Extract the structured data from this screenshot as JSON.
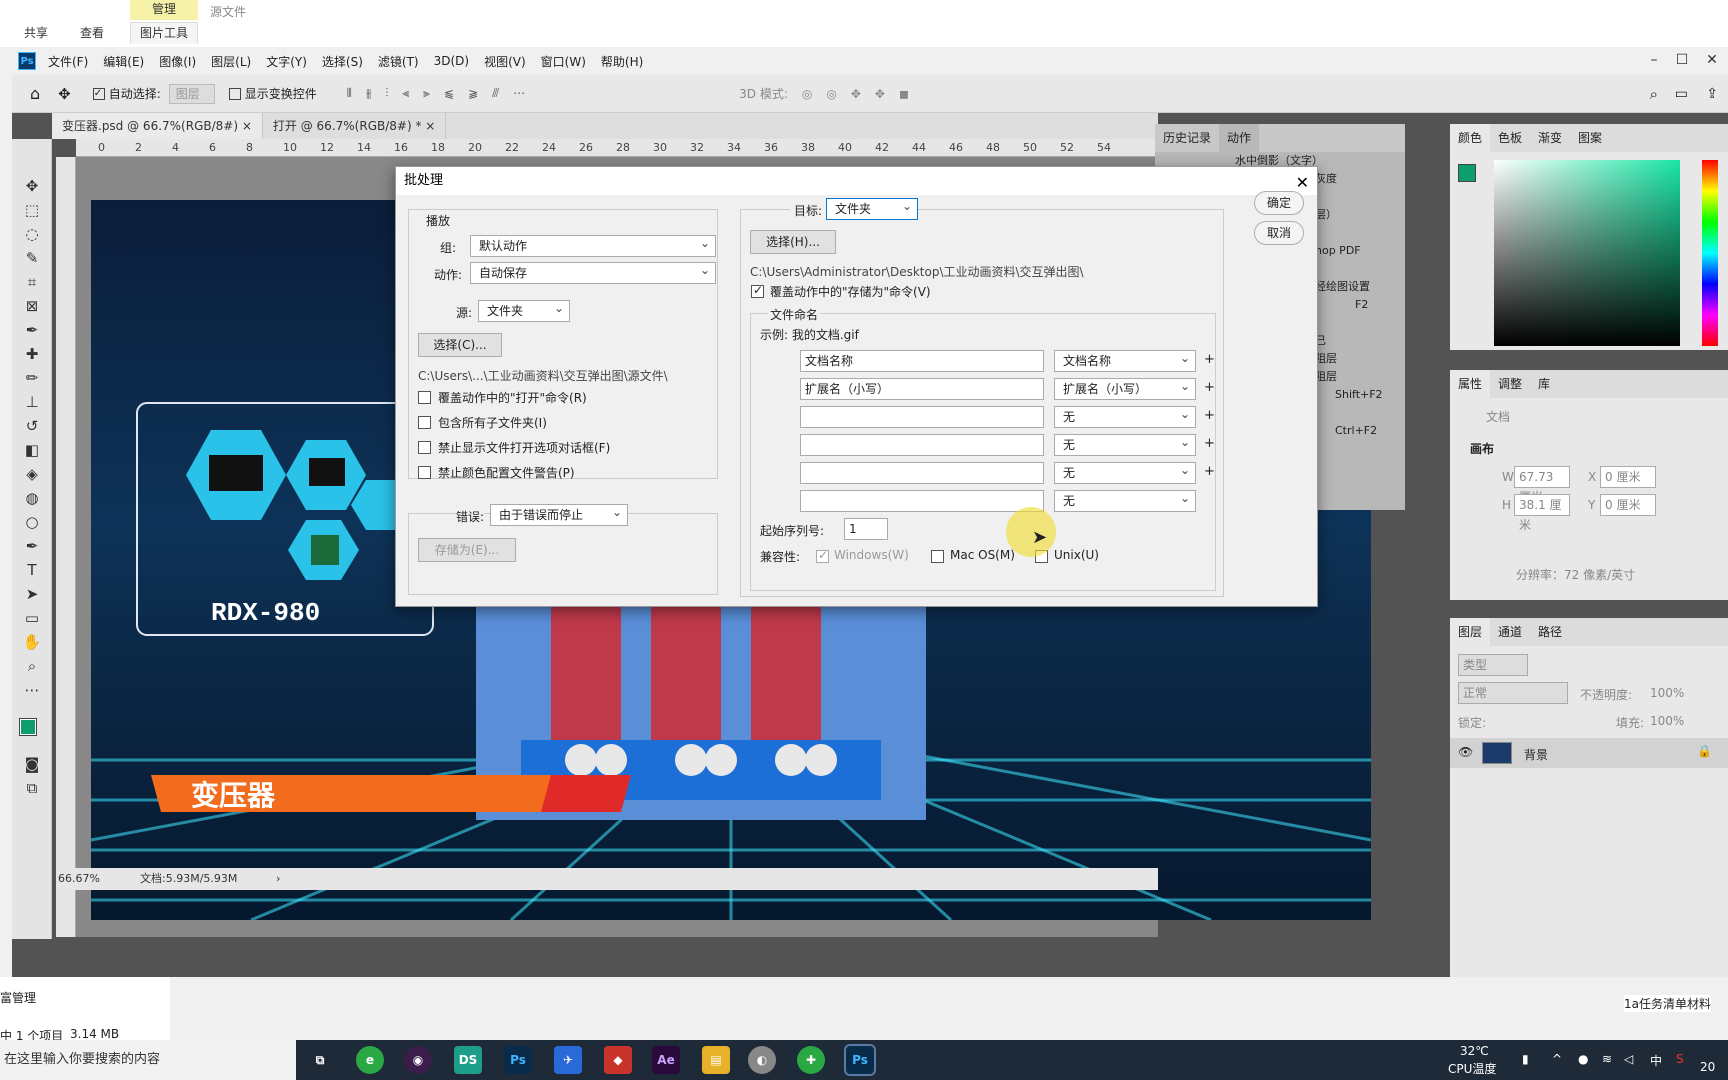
{
  "explorer": {
    "share": "共享",
    "view": "查看",
    "manage": "管理",
    "picture_tools": "图片工具",
    "source_folder": "源文件",
    "nav_item": "富管理",
    "status_items": "中 1 个项目",
    "status_size": "3.14 MB",
    "side_items": [
      "1a任务清单材料"
    ]
  },
  "photoshop": {
    "logo": "Ps",
    "menu": [
      "文件(F)",
      "编辑(E)",
      "图像(I)",
      "图层(L)",
      "文字(Y)",
      "选择(S)",
      "滤镜(T)",
      "3D(D)",
      "视图(V)",
      "窗口(W)",
      "帮助(H)"
    ],
    "options": {
      "auto_select": "自动选择:",
      "layer": "图层",
      "show_transform": "显示变换控件",
      "mode_3d": "3D 模式:"
    },
    "tabs": [
      {
        "label": "变压器.psd @ 66.7%(RGB/8#)"
      },
      {
        "label": "打开 @ 66.7%(RGB/8#) *"
      }
    ],
    "ruler_ticks": [
      "0",
      "2",
      "4",
      "6",
      "8",
      "10",
      "12",
      "14",
      "16",
      "18",
      "20",
      "22",
      "24",
      "26",
      "28",
      "30",
      "32",
      "34",
      "36",
      "38",
      "40",
      "42",
      "44",
      "46",
      "48",
      "50",
      "52",
      "54"
    ],
    "status": {
      "zoom": "66.67%",
      "doc": "文档:5.93M/5.93M"
    },
    "canvas": {
      "product_label": "RDX-980",
      "title_banner": "变压器"
    }
  },
  "history_panel": {
    "tabs": [
      "历史记录",
      "动作"
    ],
    "items": [
      "水中倒影（文字）",
      "灰度",
      "层）",
      "hop PDF",
      "经绘图设置",
      "F2",
      "已",
      "阻层",
      "阻层",
      "Shift+F2",
      "Ctrl+F2"
    ]
  },
  "color_panel": {
    "tabs": [
      "颜色",
      "色板",
      "渐变",
      "图案"
    ],
    "fg": "#0d9d6e",
    "bg": "#ffffff"
  },
  "props_panel": {
    "tabs": [
      "属性",
      "调整",
      "库"
    ],
    "doc_label": "文档",
    "section": "画布",
    "w_label": "W",
    "w_value": "67.73 厘米",
    "h_label": "H",
    "h_value": "38.1 厘米",
    "x_label": "X",
    "x_value": "0 厘米",
    "y_label": "Y",
    "y_value": "0 厘米",
    "resolution": "分辨率：72 像素/英寸"
  },
  "layers_panel": {
    "tabs": [
      "图层",
      "通道",
      "路径"
    ],
    "filter": "类型",
    "blend": "正常",
    "opacity_label": "不透明度:",
    "opacity": "100%",
    "lock_label": "锁定:",
    "fill_label": "填充:",
    "fill": "100%",
    "layer_name": "背景"
  },
  "dialog": {
    "title": "批处理",
    "play_group": "播放",
    "set_label": "组:",
    "set_value": "默认动作",
    "action_label": "动作:",
    "action_value": "自动保存",
    "source_label": "源:",
    "source_value": "文件夹",
    "choose_src": "选择(C)...",
    "src_path": "C:\\Users\\...\\工业动画资料\\交互弹出图\\源文件\\",
    "opt_override_open": "覆盖动作中的\"打开\"命令(R)",
    "opt_subfolders": "包含所有子文件夹(I)",
    "opt_suppress_open": "禁止显示文件打开选项对话框(F)",
    "opt_suppress_color": "禁止颜色配置文件警告(P)",
    "error_label": "错误:",
    "error_value": "由于错误而停止",
    "save_as": "存储为(E)...",
    "dest_label": "目标:",
    "dest_value": "文件夹",
    "choose_dest": "选择(H)...",
    "dest_path": "C:\\Users\\Administrator\\Desktop\\工业动画资料\\交互弹出图\\",
    "opt_override_save": "覆盖动作中的\"存储为\"命令(V)",
    "naming_group": "文件命名",
    "example": "示例: 我的文档.gif",
    "naming_rows": [
      {
        "text": "文档名称",
        "select": "文档名称",
        "plus": true
      },
      {
        "text": "扩展名（小写）",
        "select": "扩展名（小写）",
        "plus": true
      },
      {
        "text": "",
        "select": "无",
        "plus": true
      },
      {
        "text": "",
        "select": "无",
        "plus": true
      },
      {
        "text": "",
        "select": "无",
        "plus": true
      },
      {
        "text": "",
        "select": "无",
        "plus": false
      }
    ],
    "start_serial_label": "起始序列号:",
    "start_serial": "1",
    "compat_label": "兼容性:",
    "compat_windows": "Windows(W)",
    "compat_mac": "Mac OS(M)",
    "compat_unix": "Unix(U)",
    "ok": "确定",
    "cancel": "取消"
  },
  "taskbar": {
    "search_placeholder": "在这里输入你要搜索的内容",
    "temp": "32℃",
    "temp_label": "CPU温度",
    "ime": "中",
    "apps": [
      "DS",
      "Ps",
      "Ae",
      "Ps"
    ],
    "clock": "20"
  }
}
